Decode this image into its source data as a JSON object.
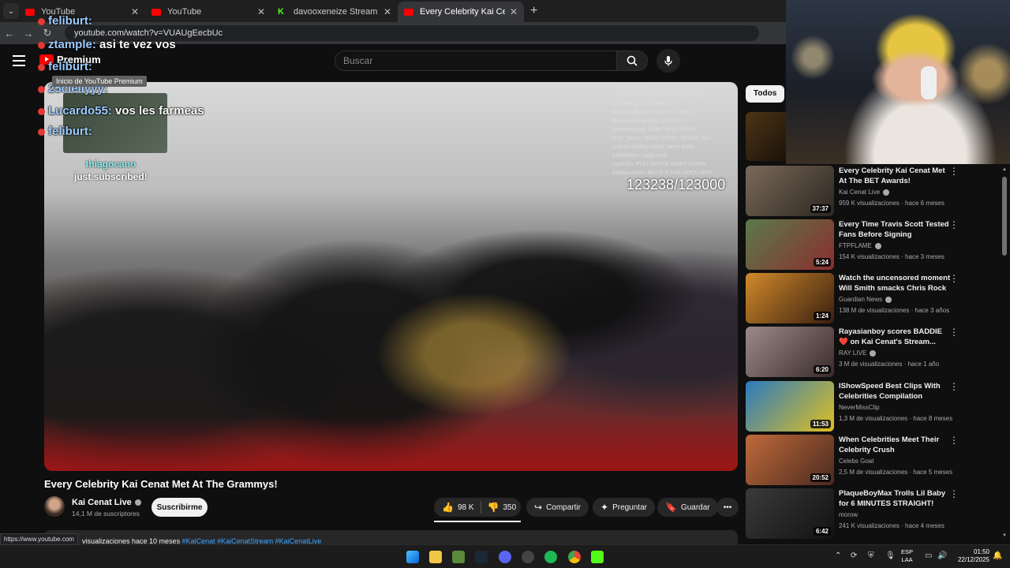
{
  "browser": {
    "tabs": [
      {
        "title": "YouTube",
        "favicon": "youtube-favicon",
        "active": false
      },
      {
        "title": "YouTube",
        "favicon": "youtube-favicon",
        "active": false
      },
      {
        "title": "davooxeneize Stream - Watch L",
        "favicon": "kick-favicon",
        "active": false
      },
      {
        "title": "Every Celebrity Kai Cenat Met A",
        "favicon": "youtube-favicon",
        "active": true
      }
    ],
    "new_tab": "+",
    "url": "youtube.com/watch?v=VUAUgEecbUc",
    "status_url": "https://www.youtube.com"
  },
  "header": {
    "logo_text": "Premium",
    "logo_tooltip": "Inicio de YouTube Premium",
    "search_placeholder": "Buscar"
  },
  "stream_overlay": {
    "chat": [
      {
        "user": "feliburt:",
        "msg": ""
      },
      {
        "user": "ztample:",
        "msg": "asi te vez vos"
      },
      {
        "user": "feliburt:",
        "msg": ""
      },
      {
        "user": "25cleilyyy:",
        "msg": ""
      },
      {
        "user": "Lucardo55:",
        "msg": "vos les farmeas"
      },
      {
        "user": "feliburt:",
        "msg": ""
      }
    ],
    "subscribed_name": "thiagocano",
    "subscribed_text": "just subscribed!"
  },
  "video": {
    "counter": "123238/123000",
    "chat_lines": [
      "lllyo36: poower",
      "sariahraven3232: BOYS IN DA HOOD",
      "keishabug14: DICKKYY",
      "focussoulfastar: Trgo to lou here",
      "noitsevanahjimuny: GOOGO",
      "pevepewjugg: DONT MISS MILEY",
      "bree_yonce: HEAR DOWN HEART your",
      "culture @lokeyraklak: we're there",
      "kaitooelitta: nigga look",
      "rayt1xlin: PULL WHITE SHIRT DOWN",
      "kiddamuskim: BOYS N THE HOOD BRO"
    ],
    "title": "Every Celebrity Kai Cenat Met At The Grammys!",
    "channel": "Kai Cenat Live",
    "subscribers": "14,1 M de suscriptores",
    "subscribe_label": "Suscribirme",
    "likes": "98 K",
    "dislikes": "350",
    "share_label": "Compartir",
    "ask_label": "Preguntar",
    "save_label": "Guardar",
    "desc_meta": "visualizaciones  hace 10 meses",
    "desc_tags": "#KaiCenat  #KaiCenatStream  #KaiCenatLive"
  },
  "sidebar": {
    "chip": "Todos",
    "recommendations": [
      {
        "title": "Every Celebrity Kai Cenat Met At The BET Awards!",
        "channel": "Kai Cenat Live",
        "verified": true,
        "views": "959 K visualizaciones",
        "age": "hace 6 meses",
        "duration": "37:37",
        "color_a": "#7a6a5a",
        "color_b": "#2c2620"
      },
      {
        "title": "Every Time Travis Scott Tested Fans Before Signing Autograp...",
        "channel": "FTPFLAME",
        "verified": true,
        "views": "154 K visualizaciones",
        "age": "hace 3 meses",
        "duration": "5:24",
        "color_a": "#5b7a4a",
        "color_b": "#8a2e2e"
      },
      {
        "title": "Watch the uncensored moment Will Smith smacks Chris Rock ...",
        "channel": "Guardian News",
        "verified": true,
        "views": "138 M de visualizaciones",
        "age": "hace 3 años",
        "duration": "1:24",
        "color_a": "#d08a2a",
        "color_b": "#3a1f10"
      },
      {
        "title": "Rayasianboy scores BADDIE❤️ on Kai Cenat's Stream...",
        "channel": "RAY LIVE",
        "verified": true,
        "views": "3 M de visualizaciones",
        "age": "hace 1 año",
        "duration": "6:20",
        "color_a": "#9a8a8a",
        "color_b": "#3a2a2a"
      },
      {
        "title": "IShowSpeed Best Clips With Celebrities Compilation",
        "channel": "NeverMissClip",
        "verified": false,
        "views": "1,3 M de visualizaciones",
        "age": "hace 8 meses",
        "duration": "11:53",
        "color_a": "#2a7ac0",
        "color_b": "#e0c020"
      },
      {
        "title": "When Celebrities Meet Their Celebrity Crush",
        "channel": "Celebs Goat",
        "verified": false,
        "views": "2,5 M de visualizaciones",
        "age": "hace 5 meses",
        "duration": "20:52",
        "color_a": "#c06a3a",
        "color_b": "#4a2a20"
      },
      {
        "title": "PlaqueBoyMax Trolls Lil Baby for 6 MINUTES STRAIGHT!",
        "channel": "morow",
        "verified": false,
        "views": "241 K visualizaciones",
        "age": "hace 4 meses",
        "duration": "6:42",
        "color_a": "#3a3a3a",
        "color_b": "#121212"
      }
    ]
  },
  "taskbar": {
    "lang_top": "ESP",
    "lang_bottom": "LAA",
    "time": "01:50",
    "date": "22/12/2025"
  }
}
